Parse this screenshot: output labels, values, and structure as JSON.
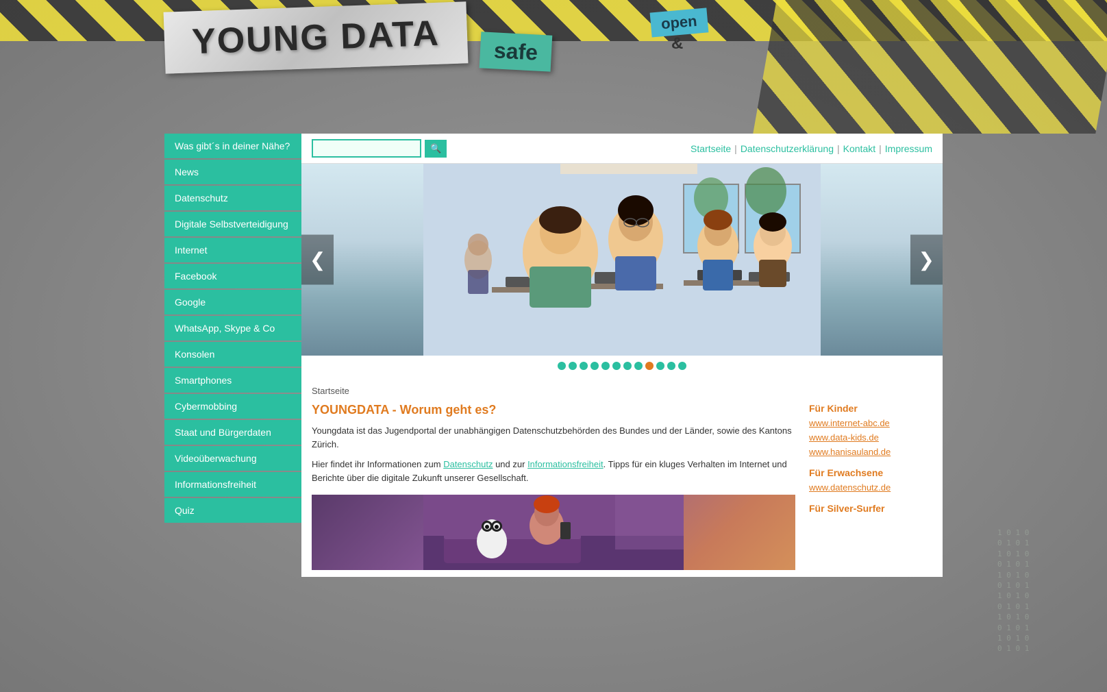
{
  "header": {
    "logo_text": "YOUNG DATA",
    "tagline_open": "open",
    "tagline_ampersand": "&",
    "tagline_safe": "safe"
  },
  "nav": {
    "search_placeholder": "",
    "search_btn_label": "🔍",
    "links": [
      {
        "label": "Startseite",
        "id": "startseite"
      },
      {
        "label": "Datenschutzerklärung",
        "id": "datenschutz-erklaerung"
      },
      {
        "label": "Kontakt",
        "id": "kontakt"
      },
      {
        "label": "Impressum",
        "id": "impressum"
      }
    ]
  },
  "sidebar": {
    "items": [
      {
        "label": "Was gibt´s in deiner Nähe?",
        "id": "was-gibts"
      },
      {
        "label": "News",
        "id": "news"
      },
      {
        "label": "Datenschutz",
        "id": "datenschutz"
      },
      {
        "label": "Digitale Selbstverteidigung",
        "id": "digitale-selbstverteidigung"
      },
      {
        "label": "Internet",
        "id": "internet"
      },
      {
        "label": "Facebook",
        "id": "facebook"
      },
      {
        "label": "Google",
        "id": "google"
      },
      {
        "label": "WhatsApp, Skype & Co",
        "id": "whatsapp"
      },
      {
        "label": "Konsolen",
        "id": "konsolen"
      },
      {
        "label": "Smartphones",
        "id": "smartphones"
      },
      {
        "label": "Cybermobbing",
        "id": "cybermobbing"
      },
      {
        "label": "Staat und Bürgerdaten",
        "id": "staat"
      },
      {
        "label": "Videoüberwachung",
        "id": "videoueberwachung"
      },
      {
        "label": "Informationsfreiheit",
        "id": "informationsfreiheit"
      },
      {
        "label": "Quiz",
        "id": "quiz"
      }
    ]
  },
  "carousel": {
    "prev_label": "❮",
    "next_label": "❯",
    "dots": [
      {
        "color": "#2bbfa0",
        "active": false
      },
      {
        "color": "#2bbfa0",
        "active": false
      },
      {
        "color": "#2bbfa0",
        "active": false
      },
      {
        "color": "#2bbfa0",
        "active": false
      },
      {
        "color": "#2bbfa0",
        "active": false
      },
      {
        "color": "#2bbfa0",
        "active": false
      },
      {
        "color": "#2bbfa0",
        "active": false
      },
      {
        "color": "#2bbfa0",
        "active": false
      },
      {
        "color": "#e07b20",
        "active": true
      },
      {
        "color": "#2bbfa0",
        "active": false
      },
      {
        "color": "#2bbfa0",
        "active": false
      },
      {
        "color": "#2bbfa0",
        "active": false
      }
    ]
  },
  "breadcrumb": "Startseite",
  "main": {
    "title": "YOUNGDATA - Worum geht es?",
    "paragraph1": "Youngdata ist das Jugendportal der unabhängigen Datenschutzbehörden des Bundes und der Länder, sowie des Kantons Zürich.",
    "paragraph2_before": "Hier findet ihr Informationen zum ",
    "link1": "Datenschutz",
    "paragraph2_mid": " und zur ",
    "link2": "Informationsfreiheit",
    "paragraph2_after": ". Tipps für ein kluges Verhalten im Internet und Berichte über die digitale Zukunft unserer Gesellschaft."
  },
  "sidebar_right": {
    "fuer_kinder_title": "Für Kinder",
    "fuer_kinder_links": [
      {
        "label": "www.internet-abc.de",
        "url": "#"
      },
      {
        "label": "www.data-kids.de",
        "url": "#"
      },
      {
        "label": "www.hanisauland.de",
        "url": "#"
      }
    ],
    "fuer_erwachsene_title": "Für Erwachsene",
    "fuer_erwachsene_links": [
      {
        "label": "www.datenschutz.de",
        "url": "#"
      }
    ],
    "fuer_silver_title": "Für Silver-Surfer"
  },
  "binary_text": "1 0 1 0\n0 1 0 1\n1 0 1 0\n0 1 0 1\n1 0 1 0\n0 1 0 1\n1 0 1 0\n0 1 0 1\n1 0 1 0\n0 1 0 1\n1 0 1 0\n0 1 0 1"
}
